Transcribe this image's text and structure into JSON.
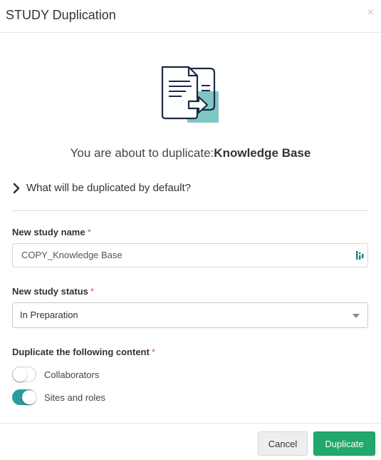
{
  "dialog": {
    "title": "STUDY Duplication",
    "close_glyph": "×"
  },
  "intro": {
    "prefix": "You are about to duplicate:",
    "study_name": "Knowledge Base"
  },
  "expander": {
    "label": "What will be duplicated by default?"
  },
  "form": {
    "name_label": "New study name",
    "name_required": "*",
    "name_value": "COPY_Knowledge Base",
    "status_label": "New study status",
    "status_required": "*",
    "status_value": "In Preparation",
    "content_label": "Duplicate the following content",
    "content_required": "*",
    "toggles": [
      {
        "label": "Collaborators",
        "checked": false
      },
      {
        "label": "Sites and roles",
        "checked": true
      }
    ]
  },
  "footer": {
    "cancel_label": "Cancel",
    "duplicate_label": "Duplicate"
  },
  "colors": {
    "accent_teal": "#2a9ba0",
    "primary_green": "#21a86a",
    "required_red": "#e0524f"
  },
  "icons": {
    "illustration": "duplicate-documents-icon",
    "expander": "chevron-right-icon",
    "field": "password-manager-icon",
    "close": "close-icon",
    "select": "caret-down-icon"
  }
}
